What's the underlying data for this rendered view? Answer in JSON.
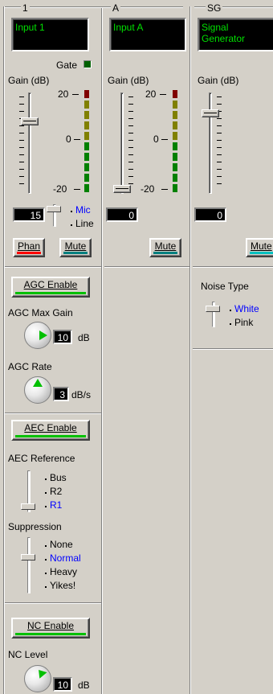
{
  "channels": [
    {
      "id": "1",
      "name": "Input 1",
      "gain_label": "Gain (dB)",
      "gain_value": "15",
      "gate_label": "Gate",
      "phan_label": "Phan",
      "mute_label": "Mute",
      "phan_color": "#ff0000",
      "mute_color": "#008080",
      "input_options": [
        "Mic",
        "Line"
      ],
      "input_selected": "Mic"
    },
    {
      "id": "A",
      "name": "Input A",
      "gain_label": "Gain (dB)",
      "gain_value": "0",
      "mute_label": "Mute",
      "mute_color": "#008080"
    },
    {
      "id": "SG",
      "name": "Signal Generator",
      "gain_label": "Gain (dB)",
      "gain_value": "0",
      "mute_label": "Mute",
      "mute_color": "#00c0c0"
    }
  ],
  "meter_labels": [
    "20",
    "0",
    "-20"
  ],
  "agc": {
    "enable_label": "AGC Enable",
    "max_gain_label": "AGC Max Gain",
    "max_gain_value": "10",
    "max_gain_unit": "dB",
    "rate_label": "AGC Rate",
    "rate_value": "3",
    "rate_unit": "dB/s"
  },
  "aec": {
    "enable_label": "AEC Enable",
    "reference_label": "AEC Reference",
    "reference_options": [
      "Bus",
      "R2",
      "R1"
    ],
    "reference_selected": "R1",
    "suppression_label": "Suppression",
    "suppression_options": [
      "None",
      "Normal",
      "Heavy",
      "Yikes!"
    ],
    "suppression_selected": "Normal"
  },
  "nc": {
    "enable_label": "NC Enable",
    "level_label": "NC Level",
    "level_value": "10",
    "level_unit": "dB"
  },
  "noise": {
    "type_label": "Noise Type",
    "options": [
      "White",
      "Pink"
    ],
    "selected": "White"
  },
  "colors": {
    "enable_bar": "#00c000",
    "knob_pointer": "#00c000",
    "selected_option": "#0000ff",
    "lcd_text": "#00e000",
    "meter_red": "#800000",
    "meter_yellow": "#808000",
    "meter_green": "#008000"
  },
  "icons": {
    "gate_led": "gate-led-icon"
  }
}
